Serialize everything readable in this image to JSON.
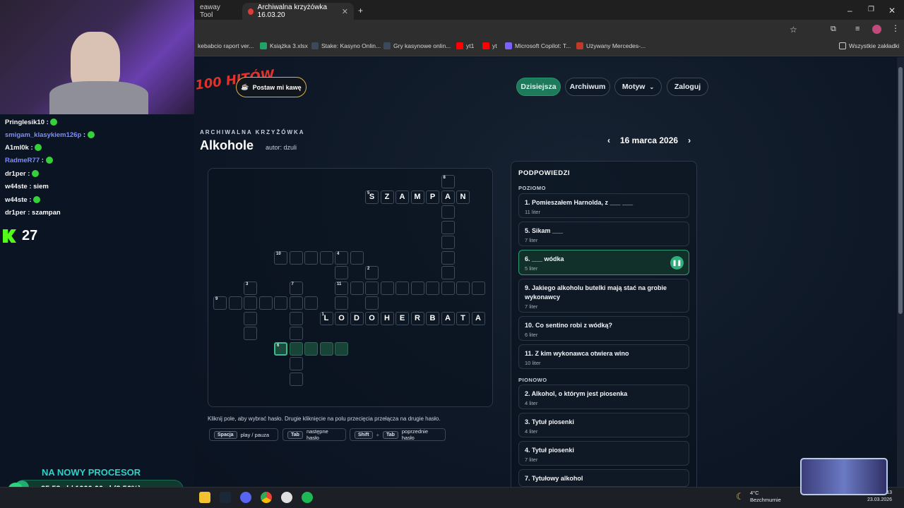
{
  "browser": {
    "tabs": [
      {
        "label": "eaway Tool"
      },
      {
        "label": "Archiwalna krzyżówka 16.03.20"
      }
    ],
    "bookmarks": [
      {
        "label": "kebabcio raport ver...",
        "color": "#ffffff"
      },
      {
        "label": "Książka 3.xlsx",
        "color": "#21a366"
      },
      {
        "label": "Stake: Kasyno Onlin...",
        "color": "#ffffff"
      },
      {
        "label": "Gry kasynowe onlin...",
        "color": "#ffffff"
      },
      {
        "label": "yt1",
        "color": "#ff0000"
      },
      {
        "label": "yt",
        "color": "#ff0000"
      },
      {
        "label": "Microsoft Copilot: T...",
        "color": "#7b61ff"
      },
      {
        "label": "Używany Mercedes-...",
        "color": "#c0392b"
      }
    ],
    "all_bookmarks": "Wszystkie zakładki"
  },
  "site": {
    "logo": "100 HITÓW",
    "coffee_button": "Postaw mi kawę",
    "nav": {
      "today": "Dzisiejsza",
      "archive": "Archiwum",
      "theme": "Motyw",
      "login": "Zaloguj"
    },
    "eyebrow": "ARCHIWALNA KRZYŻÓWKA",
    "title": "Alkohole",
    "author": "autor: dzuli",
    "date": "16 marca 2026",
    "hint": "Kliknij pole, aby wybrać hasło. Drugie kliknięcie na polu przecięcia przełącza na drugie hasło.",
    "shortcuts": [
      {
        "keys": [
          "Spacja"
        ],
        "label": "play / pauza"
      },
      {
        "keys": [
          "Tab"
        ],
        "label": "następne hasło"
      },
      {
        "keys": [
          "Shift",
          "Tab"
        ],
        "label": "poprzednie hasło",
        "sep": "+"
      }
    ]
  },
  "clues": {
    "heading": "PODPOWIEDZI",
    "across_label": "POZIOMO",
    "down_label": "PIONOWO",
    "across": [
      {
        "text": "1. Pomieszałem Harnolda, z ___ ___",
        "len": "11 liter"
      },
      {
        "text": "5. Sikam ___",
        "len": "7 liter"
      },
      {
        "text": "6. ___ wódka",
        "len": "5 liter",
        "active": true
      },
      {
        "text": "9. Jakiego alkoholu butelki mają stać na grobie wykonawcy",
        "len": "7 liter"
      },
      {
        "text": "10. Co sentino robi z wódką?",
        "len": "6 liter"
      },
      {
        "text": "11. Z kim wykonawca otwiera wino",
        "len": "10 liter"
      }
    ],
    "down": [
      {
        "text": "2. Alkohol, o którym jest piosenka",
        "len": "4 liter"
      },
      {
        "text": "3. Tytuł piosenki",
        "len": "4 liter"
      },
      {
        "text": "4. Tytuł piosenki",
        "len": "7 liter"
      },
      {
        "text": "7. Tytułowy alkohol",
        "len": "7 liter"
      }
    ]
  },
  "grid": {
    "row_szampan": [
      "S",
      "Z",
      "A",
      "M",
      "P",
      "A",
      "N"
    ],
    "row_lodoherbata": [
      "L",
      "O",
      "D",
      "O",
      "H",
      "E",
      "R",
      "B",
      "A",
      "T",
      "A"
    ],
    "numbers": [
      "8",
      "5",
      "10",
      "4",
      "2",
      "3",
      "7",
      "11",
      "9",
      "1",
      "6"
    ]
  },
  "stream": {
    "chat": [
      {
        "user": "Pringlesik10",
        "color": "#f5f5f5",
        "msg": ""
      },
      {
        "user": "smigam_klasykiem126p",
        "color": "#7f8cff",
        "msg": ""
      },
      {
        "user": "A1ml0k",
        "color": "#f5f5f5",
        "msg": ""
      },
      {
        "user": "RadmeR77",
        "color": "#7f8cff",
        "msg": ""
      },
      {
        "user": "dr1per",
        "color": "#f5f5f5",
        "msg": ""
      },
      {
        "user": "w44ste",
        "color": "#f5f5f5",
        "msg": "siem"
      },
      {
        "user": "w44ste",
        "color": "#f5f5f5",
        "msg": ""
      },
      {
        "user": "dr1per",
        "color": "#f5f5f5",
        "msg": "szampan"
      }
    ],
    "viewers": "27",
    "goal_title": "NA NOWY PROCESOR",
    "goal_value": "85,58 zł / 1000,00 zł (8.56%)",
    "goal_fraction": 0.0856
  },
  "taskbar": {
    "temp": "4°C",
    "weather": "Bezchmurnie",
    "time": "13",
    "date": "23.03.2026"
  }
}
